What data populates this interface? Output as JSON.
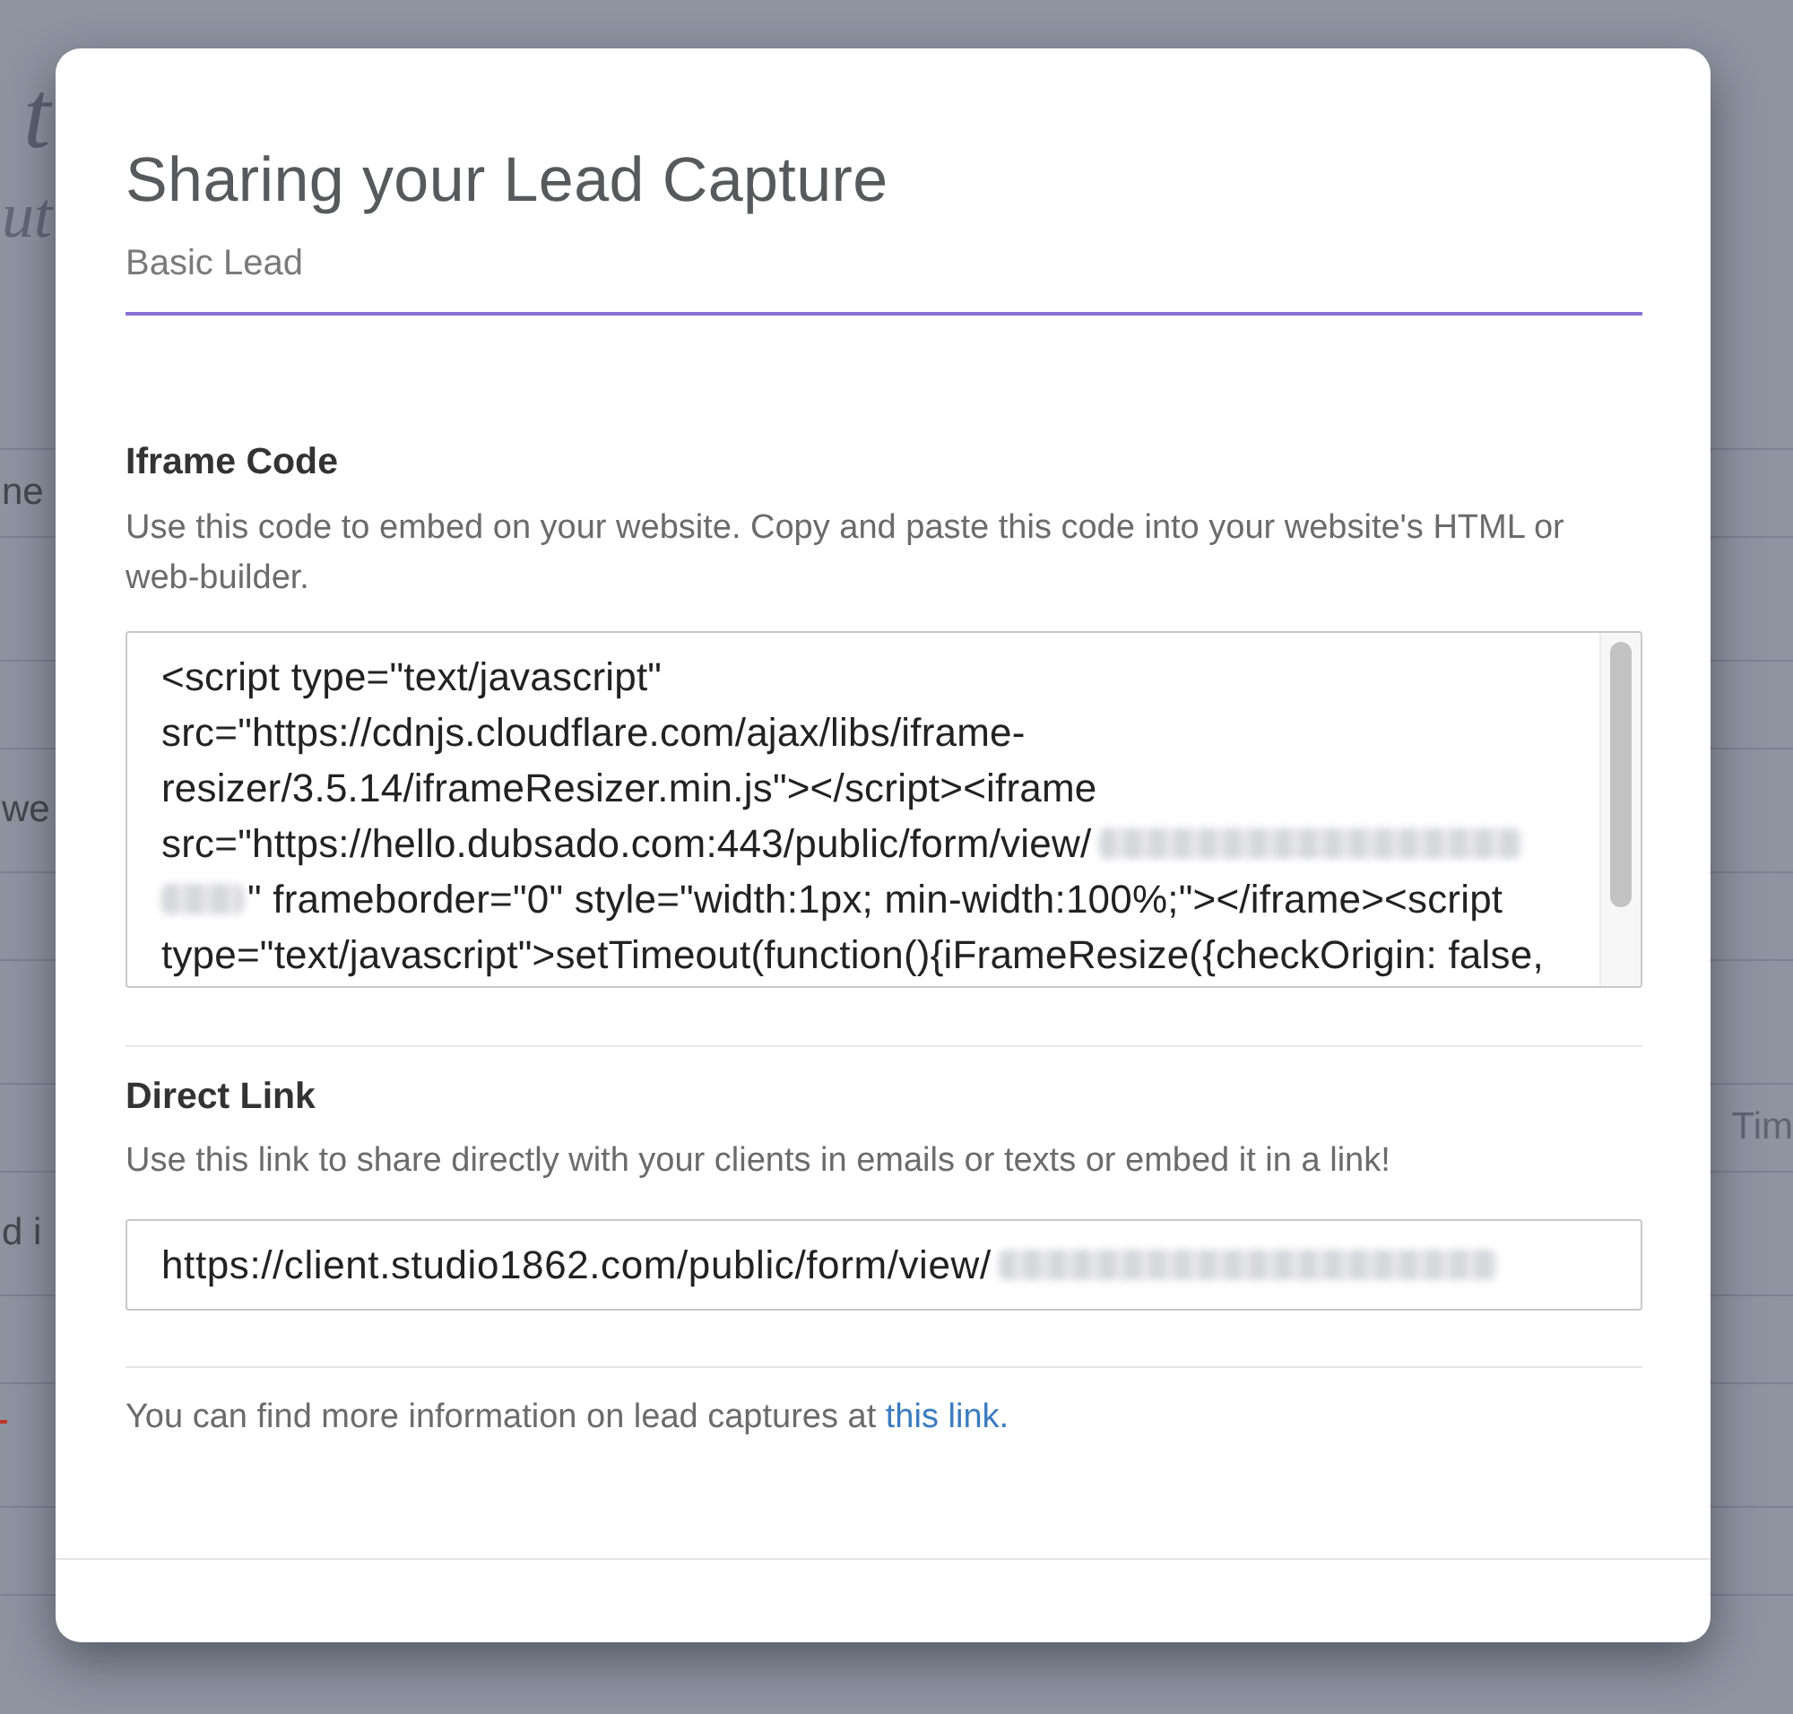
{
  "background_page": {
    "title_fragment": "t",
    "subtitle_fragment": "ut",
    "left_fragments": [
      "ne",
      "we",
      "d i"
    ],
    "right_fragments": [
      "Tim"
    ]
  },
  "modal": {
    "title": "Sharing your Lead Capture",
    "subtitle": "Basic Lead",
    "sections": [
      {
        "kind": "code",
        "heading": "Iframe Code",
        "description": "Use this code to embed on your website. Copy and paste this code into your website's HTML or web-builder.",
        "lines": [
          [
            {
              "kind": "text",
              "text": "<script type=\"text/javascript\""
            }
          ],
          [
            {
              "kind": "text",
              "text": "src=\"https://cdnjs.cloudflare.com/ajax/libs/iframe-"
            }
          ],
          [
            {
              "kind": "text",
              "text": "resizer/3.5.14/iframeResizer.min.js\"></script><iframe"
            }
          ],
          [
            {
              "kind": "text",
              "text": "src=\"https://hello.dubsado.com:443/public/form/view/"
            },
            {
              "kind": "redacted"
            }
          ],
          [
            {
              "kind": "redacted"
            },
            {
              "kind": "text",
              "text": "\" frameborder=\"0\" style=\"width:1px; min-width:100%;\"></iframe><script"
            }
          ],
          [
            {
              "kind": "text",
              "text": "type=\"text/javascript\">setTimeout(function(){iFrameResize({checkOrigin: false,"
            }
          ]
        ]
      },
      {
        "kind": "link",
        "heading": "Direct Link",
        "description": "Use this link to share directly with your clients in emails or texts or embed it in a link!",
        "value": [
          {
            "kind": "text",
            "text": "https://client.studio1862.com/public/form/view/"
          },
          {
            "kind": "redacted"
          }
        ]
      }
    ],
    "note": {
      "text": "You can find more information on lead captures at ",
      "link": "this link."
    }
  }
}
